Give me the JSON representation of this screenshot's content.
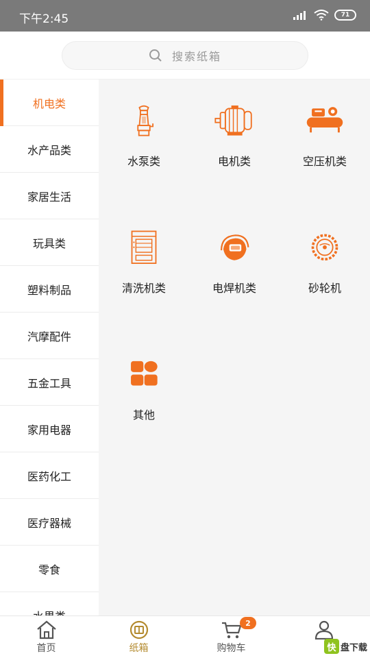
{
  "status": {
    "time": "下午2:45",
    "battery": "71"
  },
  "search": {
    "placeholder": "搜索纸箱"
  },
  "sidebar": {
    "items": [
      {
        "label": "机电类",
        "active": true
      },
      {
        "label": "水产品类"
      },
      {
        "label": "家居生活"
      },
      {
        "label": "玩具类"
      },
      {
        "label": "塑料制品"
      },
      {
        "label": "汽摩配件"
      },
      {
        "label": "五金工具"
      },
      {
        "label": "家用电器"
      },
      {
        "label": "医药化工"
      },
      {
        "label": "医疗器械"
      },
      {
        "label": "零食"
      },
      {
        "label": "水果类"
      }
    ]
  },
  "grid": {
    "items": [
      {
        "label": "水泵类",
        "icon": "water-pump-icon"
      },
      {
        "label": "电机类",
        "icon": "motor-icon"
      },
      {
        "label": "空压机类",
        "icon": "air-compressor-icon"
      },
      {
        "label": "清洗机类",
        "icon": "washing-machine-icon"
      },
      {
        "label": "电焊机类",
        "icon": "welding-mask-icon"
      },
      {
        "label": "砂轮机",
        "icon": "grinding-wheel-icon"
      },
      {
        "label": "其他",
        "icon": "grid-four-icon"
      }
    ]
  },
  "bottom_nav": {
    "items": [
      {
        "label": "首页",
        "icon": "home-icon"
      },
      {
        "label": "纸箱",
        "icon": "box-icon",
        "active": true
      },
      {
        "label": "购物车",
        "icon": "cart-icon",
        "badge": "2"
      },
      {
        "label": "",
        "icon": "user-icon"
      }
    ]
  },
  "watermark": {
    "badge": "快",
    "text": "盘下载"
  },
  "colors": {
    "accent": "#f07020",
    "active_nav": "#b38a2e",
    "status_bar": "#7a7a7a"
  }
}
